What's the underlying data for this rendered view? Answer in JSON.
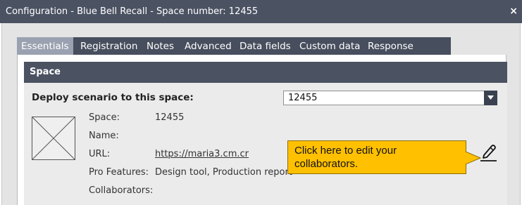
{
  "window": {
    "title": "Configuration - Blue Bell Recall - Space number: 12455",
    "close_glyph": "×"
  },
  "tabs": [
    {
      "label": "Essentials",
      "active": true
    },
    {
      "label": "Registration"
    },
    {
      "label": "Notes"
    },
    {
      "label": "Advanced"
    },
    {
      "label": "Data fields"
    },
    {
      "label": "Custom data"
    },
    {
      "label": "Response Report"
    }
  ],
  "panel": {
    "header": "Space",
    "deploy_label": "Deploy scenario to this space:",
    "deploy_value": "12455",
    "fields": {
      "space_label": "Space:",
      "space_value": "12455",
      "name_label": "Name:",
      "url_label": "URL:",
      "url_value": "https://maria3.cm.cr",
      "pro_label": "Pro Features:",
      "pro_value": "Design tool, Production report",
      "collab_label": "Collaborators:"
    }
  },
  "callout": {
    "text": "Click here to edit your collaborators."
  },
  "icons": {
    "edit": "pencil-icon",
    "image": "image-placeholder-icon",
    "dropdown": "chevron-down-icon"
  },
  "colors": {
    "header": "#4b5262",
    "callout": "#ffc000"
  }
}
